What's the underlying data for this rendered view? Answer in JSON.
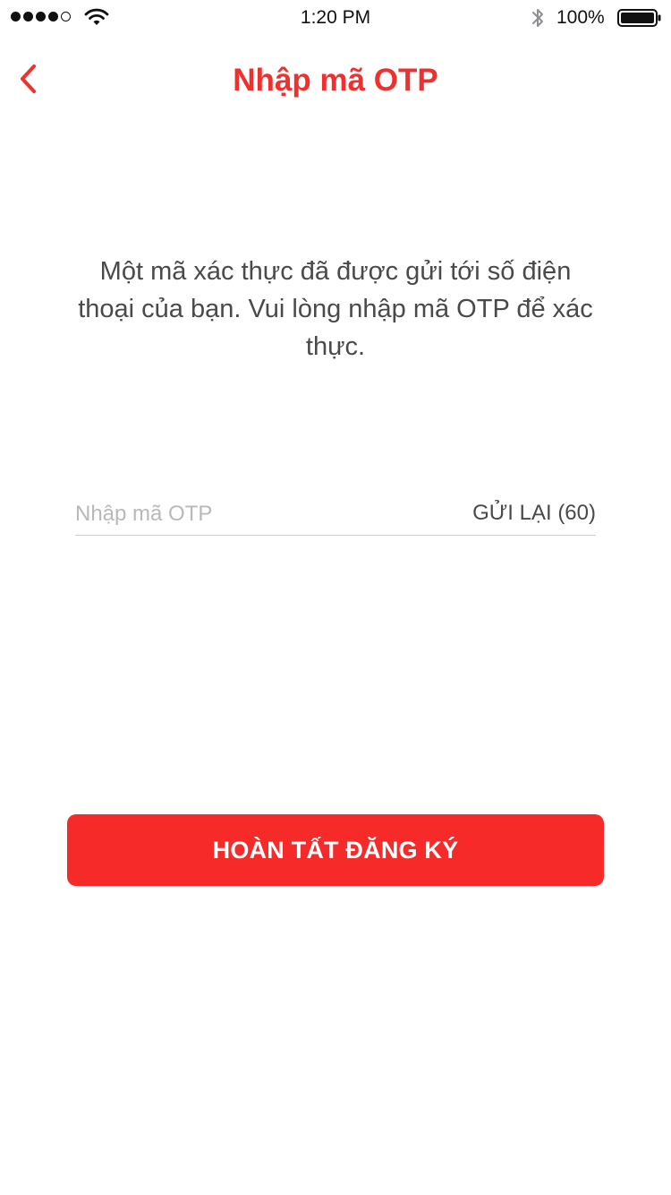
{
  "status_bar": {
    "time": "1:20 PM",
    "battery_percent": "100%",
    "signal_bars_filled": 4,
    "signal_bars_total": 5,
    "icons": [
      "signal-icon",
      "wifi-icon",
      "bluetooth-icon",
      "battery-icon"
    ]
  },
  "nav": {
    "title": "Nhập mã OTP",
    "back_icon": "chevron-left-icon"
  },
  "content": {
    "description": "Một mã xác thực đã được gửi tới số điện thoại của bạn. Vui lòng nhập mã OTP để xác thực."
  },
  "otp": {
    "placeholder": "Nhập mã OTP",
    "value": "",
    "resend_label": "GỬI LẠI (60)"
  },
  "actions": {
    "submit_label": "HOÀN TẤT ĐĂNG KÝ"
  },
  "colors": {
    "accent": "#f0302f",
    "button": "#f72a2a",
    "text": "#4a4a4a",
    "placeholder": "#b9b9b9",
    "divider": "#cfcfcf"
  }
}
